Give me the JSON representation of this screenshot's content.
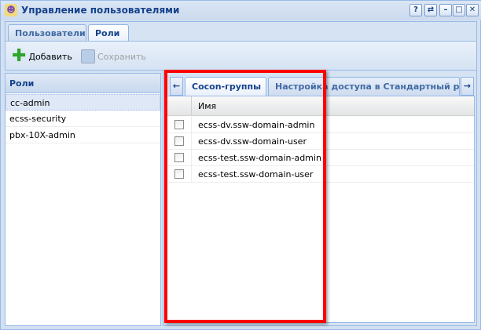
{
  "window": {
    "title": "Управление пользователями",
    "buttons": [
      "?",
      "⇄",
      "–",
      "□",
      "✕"
    ]
  },
  "tabs": [
    {
      "label": "Пользователи",
      "active": false
    },
    {
      "label": "Роли",
      "active": true
    }
  ],
  "toolbar": {
    "add_label": "Добавить",
    "save_label": "Сохранить",
    "save_disabled": true
  },
  "roles": {
    "header": "Роли",
    "items": [
      {
        "label": "cc-admin",
        "selected": true
      },
      {
        "label": "ecss-security"
      },
      {
        "label": "pbx-10X-admin"
      }
    ]
  },
  "inner_tabs": [
    {
      "label": "Cocon-группы",
      "active": true
    },
    {
      "label": "Настройка доступа в Стандартный режи",
      "active": false
    }
  ],
  "grid": {
    "column": "Имя",
    "rows": [
      {
        "name": "ecss-dv.ssw-domain-admin",
        "checked": false
      },
      {
        "name": "ecss-dv.ssw-domain-user",
        "checked": false
      },
      {
        "name": "ecss-test.ssw-domain-admin",
        "checked": false
      },
      {
        "name": "ecss-test.ssw-domain-user",
        "checked": false
      }
    ]
  },
  "colors": {
    "highlight": "#ff0000",
    "title": "#15428b"
  }
}
